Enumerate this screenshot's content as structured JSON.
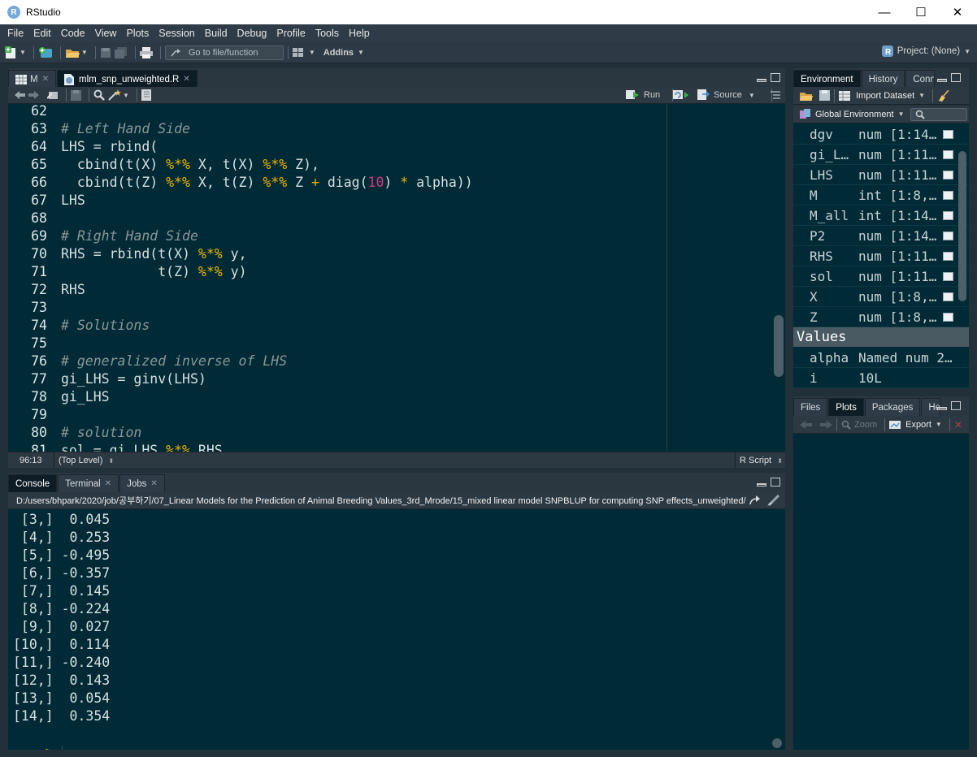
{
  "window": {
    "title": "RStudio",
    "minimize": "—",
    "maximize": "☐",
    "close": "✕"
  },
  "menu": [
    "File",
    "Edit",
    "Code",
    "View",
    "Plots",
    "Session",
    "Build",
    "Debug",
    "Profile",
    "Tools",
    "Help"
  ],
  "toolbar": {
    "goto_placeholder": "Go to file/function",
    "addins_label": "Addins",
    "project_label": "Project: (None)"
  },
  "editor": {
    "tabs": [
      {
        "label": "M"
      },
      {
        "label": "mlm_snp_unweighted.R"
      }
    ],
    "run_label": "Run",
    "source_label": "Source",
    "lines": [
      {
        "n": "62",
        "tokens": []
      },
      {
        "n": "63",
        "tokens": [
          {
            "t": "# Left Hand Side",
            "c": "comment"
          }
        ]
      },
      {
        "n": "64",
        "tokens": [
          {
            "t": "LHS = rbind(",
            "c": "plain"
          }
        ]
      },
      {
        "n": "65",
        "tokens": [
          {
            "t": "  cbind(t(X) ",
            "c": "plain"
          },
          {
            "t": "%*%",
            "c": "op"
          },
          {
            "t": " X, t(X) ",
            "c": "plain"
          },
          {
            "t": "%*%",
            "c": "op"
          },
          {
            "t": " Z),",
            "c": "plain"
          }
        ]
      },
      {
        "n": "66",
        "tokens": [
          {
            "t": "  cbind(t(Z) ",
            "c": "plain"
          },
          {
            "t": "%*%",
            "c": "op"
          },
          {
            "t": " X, t(Z) ",
            "c": "plain"
          },
          {
            "t": "%*%",
            "c": "op"
          },
          {
            "t": " Z ",
            "c": "plain"
          },
          {
            "t": "+",
            "c": "op"
          },
          {
            "t": " diag(",
            "c": "plain"
          },
          {
            "t": "10",
            "c": "num"
          },
          {
            "t": ") ",
            "c": "plain"
          },
          {
            "t": "*",
            "c": "op"
          },
          {
            "t": " alpha))",
            "c": "plain"
          }
        ]
      },
      {
        "n": "67",
        "tokens": [
          {
            "t": "LHS",
            "c": "plain"
          }
        ]
      },
      {
        "n": "68",
        "tokens": []
      },
      {
        "n": "69",
        "tokens": [
          {
            "t": "# Right Hand Side",
            "c": "comment"
          }
        ]
      },
      {
        "n": "70",
        "tokens": [
          {
            "t": "RHS = rbind(t(X) ",
            "c": "plain"
          },
          {
            "t": "%*%",
            "c": "op"
          },
          {
            "t": " y,",
            "c": "plain"
          }
        ]
      },
      {
        "n": "71",
        "tokens": [
          {
            "t": "            t(Z) ",
            "c": "plain"
          },
          {
            "t": "%*%",
            "c": "op"
          },
          {
            "t": " y)",
            "c": "plain"
          }
        ]
      },
      {
        "n": "72",
        "tokens": [
          {
            "t": "RHS",
            "c": "plain"
          }
        ]
      },
      {
        "n": "73",
        "tokens": []
      },
      {
        "n": "74",
        "tokens": [
          {
            "t": "# Solutions",
            "c": "comment"
          }
        ]
      },
      {
        "n": "75",
        "tokens": []
      },
      {
        "n": "76",
        "tokens": [
          {
            "t": "# generalized inverse of LHS",
            "c": "comment"
          }
        ]
      },
      {
        "n": "77",
        "tokens": [
          {
            "t": "gi_LHS = ginv(LHS)",
            "c": "plain"
          }
        ]
      },
      {
        "n": "78",
        "tokens": [
          {
            "t": "gi_LHS",
            "c": "plain"
          }
        ]
      },
      {
        "n": "79",
        "tokens": []
      },
      {
        "n": "80",
        "tokens": [
          {
            "t": "# solution",
            "c": "comment"
          }
        ]
      },
      {
        "n": "81",
        "tokens": [
          {
            "t": "sol = gi_LHS ",
            "c": "plain"
          },
          {
            "t": "%*%",
            "c": "op"
          },
          {
            "t": " RHS",
            "c": "plain"
          }
        ]
      }
    ],
    "status_position": "96:13",
    "status_scope": "(Top Level)",
    "status_filetype": "R Script"
  },
  "console": {
    "tabs": [
      {
        "label": "Console"
      },
      {
        "label": "Terminal"
      },
      {
        "label": "Jobs"
      }
    ],
    "path": "D:/users/bhpark/2020/job/공부하기/07_Linear Models for the Prediction of Animal Breeding Values_3rd_Mrode/15_mixed linear model SNPBLUP for computing SNP effects_unweighted/",
    "output": [
      " [3,]  0.045",
      " [4,]  0.253",
      " [5,] -0.495",
      " [6,] -0.357",
      " [7,]  0.145",
      " [8,] -0.224",
      " [9,]  0.027",
      "[10,]  0.114",
      "[11,] -0.240",
      "[12,]  0.143",
      "[13,]  0.054",
      "[14,]  0.354"
    ],
    "prompt": ">"
  },
  "env": {
    "tabs": [
      {
        "label": "Environment"
      },
      {
        "label": "History"
      },
      {
        "label": "Conn"
      }
    ],
    "import_label": "Import Dataset",
    "scope_label": "Global Environment",
    "data_rows": [
      {
        "name": "dgv",
        "value": "num [1:14…"
      },
      {
        "name": "gi_L…",
        "value": "num [1:11…"
      },
      {
        "name": "LHS",
        "value": "num [1:11…"
      },
      {
        "name": "M",
        "value": "int [1:8,…"
      },
      {
        "name": "M_all",
        "value": "int [1:14…"
      },
      {
        "name": "P2",
        "value": "num [1:14…"
      },
      {
        "name": "RHS",
        "value": "num [1:11…"
      },
      {
        "name": "sol",
        "value": "num [1:11…"
      },
      {
        "name": "X",
        "value": "num [1:8,…"
      },
      {
        "name": "Z",
        "value": "num [1:8,…"
      }
    ],
    "values_header": "Values",
    "values_rows": [
      {
        "name": "alpha",
        "value": "Named num 2…"
      },
      {
        "name": "i",
        "value": "10L"
      }
    ]
  },
  "files": {
    "tabs": [
      {
        "label": "Files"
      },
      {
        "label": "Plots"
      },
      {
        "label": "Packages"
      },
      {
        "label": "He"
      }
    ],
    "zoom_label": "Zoom",
    "export_label": "Export"
  }
}
